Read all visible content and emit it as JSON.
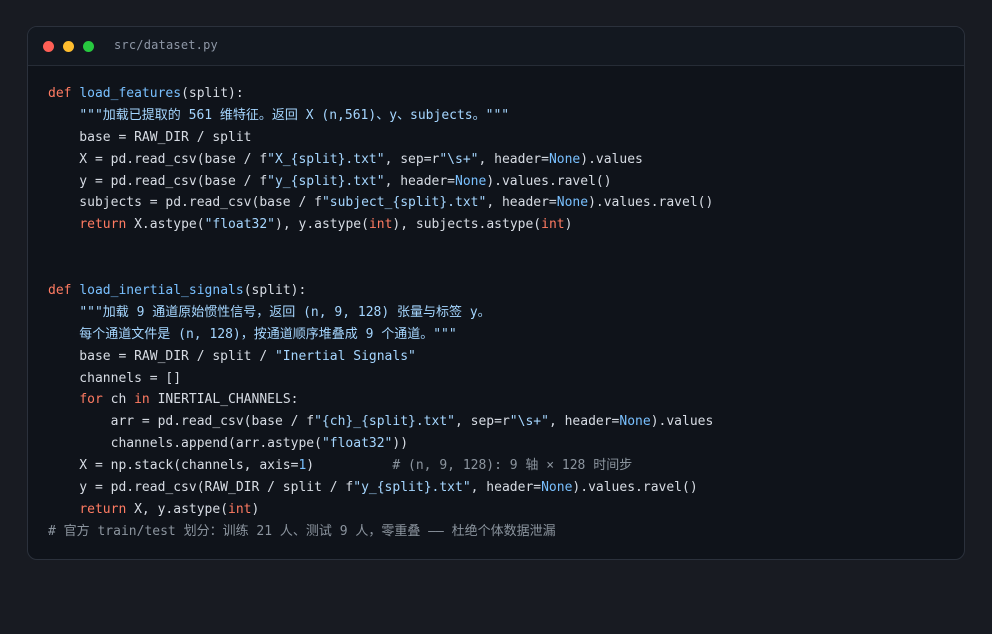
{
  "window": {
    "filename": "src/dataset.py",
    "traffic_colors": {
      "close": "#ff5f56",
      "minimize": "#ffbd2e",
      "maximize": "#27c93f"
    }
  },
  "code": {
    "lines": [
      [
        {
          "t": "kw",
          "v": "def "
        },
        {
          "t": "fn",
          "v": "load_features"
        },
        {
          "t": "pl",
          "v": "(split):"
        }
      ],
      [
        {
          "t": "pl",
          "v": "    "
        },
        {
          "t": "str",
          "v": "\"\"\"加载已提取的 561 维特征。返回 X (n,561)、y、subjects。\"\"\""
        }
      ],
      [
        {
          "t": "pl",
          "v": "    base = RAW_DIR / split"
        }
      ],
      [
        {
          "t": "pl",
          "v": "    X = pd.read_csv(base / f"
        },
        {
          "t": "str",
          "v": "\"X_{split}.txt\""
        },
        {
          "t": "pl",
          "v": ", sep=r"
        },
        {
          "t": "str",
          "v": "\"\\s+\""
        },
        {
          "t": "pl",
          "v": ", header="
        },
        {
          "t": "cn",
          "v": "None"
        },
        {
          "t": "pl",
          "v": ").values"
        }
      ],
      [
        {
          "t": "pl",
          "v": "    y = pd.read_csv(base / f"
        },
        {
          "t": "str",
          "v": "\"y_{split}.txt\""
        },
        {
          "t": "pl",
          "v": ", header="
        },
        {
          "t": "cn",
          "v": "None"
        },
        {
          "t": "pl",
          "v": ").values.ravel()"
        }
      ],
      [
        {
          "t": "pl",
          "v": "    subjects = pd.read_csv(base / f"
        },
        {
          "t": "str",
          "v": "\"subject_{split}.txt\""
        },
        {
          "t": "pl",
          "v": ", header="
        },
        {
          "t": "cn",
          "v": "None"
        },
        {
          "t": "pl",
          "v": ").values.ravel()"
        }
      ],
      [
        {
          "t": "pl",
          "v": "    "
        },
        {
          "t": "kw",
          "v": "return"
        },
        {
          "t": "pl",
          "v": " X.astype("
        },
        {
          "t": "str",
          "v": "\"float32\""
        },
        {
          "t": "pl",
          "v": "), y.astype("
        },
        {
          "t": "kw",
          "v": "int"
        },
        {
          "t": "pl",
          "v": "), subjects.astype("
        },
        {
          "t": "kw",
          "v": "int"
        },
        {
          "t": "pl",
          "v": ")"
        }
      ],
      [],
      [],
      [
        {
          "t": "kw",
          "v": "def "
        },
        {
          "t": "fn",
          "v": "load_inertial_signals"
        },
        {
          "t": "pl",
          "v": "(split):"
        }
      ],
      [
        {
          "t": "pl",
          "v": "    "
        },
        {
          "t": "str",
          "v": "\"\"\"加载 9 通道原始惯性信号，返回 (n, 9, 128) 张量与标签 y。"
        }
      ],
      [
        {
          "t": "str",
          "v": "    每个通道文件是 (n, 128)，按通道顺序堆叠成 9 个通道。\"\"\""
        }
      ],
      [
        {
          "t": "pl",
          "v": "    base = RAW_DIR / split / "
        },
        {
          "t": "str",
          "v": "\"Inertial Signals\""
        }
      ],
      [
        {
          "t": "pl",
          "v": "    channels = []"
        }
      ],
      [
        {
          "t": "pl",
          "v": "    "
        },
        {
          "t": "kw",
          "v": "for"
        },
        {
          "t": "pl",
          "v": " ch "
        },
        {
          "t": "kw",
          "v": "in"
        },
        {
          "t": "pl",
          "v": " INERTIAL_CHANNELS:"
        }
      ],
      [
        {
          "t": "pl",
          "v": "        arr = pd.read_csv(base / f"
        },
        {
          "t": "str",
          "v": "\"{ch}_{split}.txt\""
        },
        {
          "t": "pl",
          "v": ", sep=r"
        },
        {
          "t": "str",
          "v": "\"\\s+\""
        },
        {
          "t": "pl",
          "v": ", header="
        },
        {
          "t": "cn",
          "v": "None"
        },
        {
          "t": "pl",
          "v": ").values"
        }
      ],
      [
        {
          "t": "pl",
          "v": "        channels.append(arr.astype("
        },
        {
          "t": "str",
          "v": "\"float32\""
        },
        {
          "t": "pl",
          "v": "))"
        }
      ],
      [
        {
          "t": "pl",
          "v": "    X = np.stack(channels, axis="
        },
        {
          "t": "cn",
          "v": "1"
        },
        {
          "t": "pl",
          "v": ")          "
        },
        {
          "t": "cm",
          "v": "# (n, 9, 128): 9 轴 × 128 时间步"
        }
      ],
      [
        {
          "t": "pl",
          "v": "    y = pd.read_csv(RAW_DIR / split / f"
        },
        {
          "t": "str",
          "v": "\"y_{split}.txt\""
        },
        {
          "t": "pl",
          "v": ", header="
        },
        {
          "t": "cn",
          "v": "None"
        },
        {
          "t": "pl",
          "v": ").values.ravel()"
        }
      ],
      [
        {
          "t": "pl",
          "v": "    "
        },
        {
          "t": "kw",
          "v": "return"
        },
        {
          "t": "pl",
          "v": " X, y.astype("
        },
        {
          "t": "kw",
          "v": "int"
        },
        {
          "t": "pl",
          "v": ")"
        }
      ],
      [
        {
          "t": "cm",
          "v": "# 官方 train/test 划分：训练 21 人、测试 9 人，零重叠 —— 杜绝个体数据泄漏"
        }
      ]
    ]
  }
}
